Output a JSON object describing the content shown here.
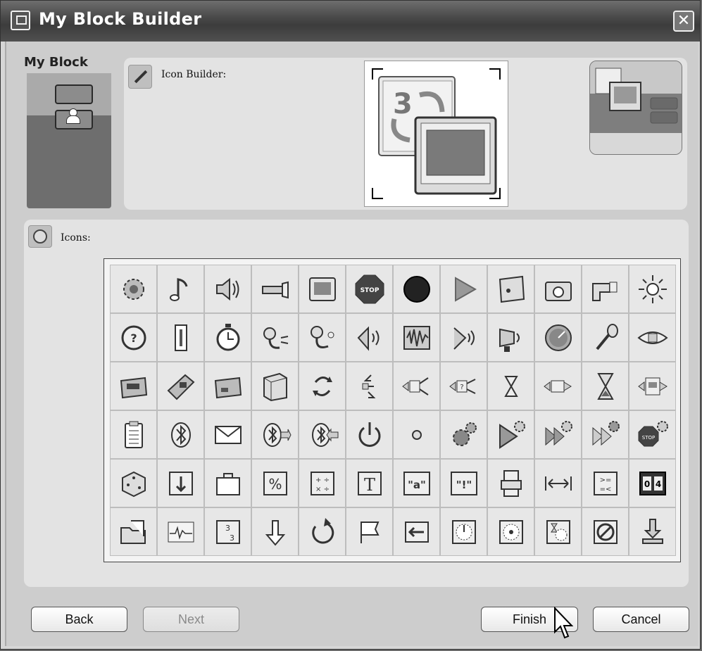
{
  "window": {
    "title": "My Block Builder",
    "close_symbol": "✕"
  },
  "my_block": {
    "label": "My Block"
  },
  "icon_builder": {
    "label": "Icon Builder:",
    "canvas_number": "3"
  },
  "icons_section": {
    "label": "Icons:",
    "icons": [
      [
        "gear",
        "music-note",
        "speaker",
        "flashlight",
        "display",
        "stop-sign",
        "red-lamp",
        "play",
        "sound-file",
        "camera",
        "light-sensor",
        "sun"
      ],
      [
        "rotation-sensor",
        "thermometer",
        "timer",
        "sound-sensor",
        "touch-probe",
        "ultrasonic",
        "waveform",
        "radar",
        "lamp-sensor",
        "compass",
        "microphone",
        "eye"
      ],
      [
        "nxt-brick",
        "nxt-brick-tilted",
        "nxt-brick-2",
        "nxt-brick-box",
        "loop",
        "switch",
        "variable-compare",
        "data-compare",
        "hourglass-small",
        "data-range",
        "hourglass",
        "keep-alive"
      ],
      [
        "notepad",
        "bluetooth",
        "mail",
        "bluetooth-send",
        "bluetooth-receive",
        "power",
        "dot",
        "gear-motor",
        "play-gear",
        "fast-forward-gear",
        "motor-forward",
        "stop-gear"
      ],
      [
        "random-dice",
        "arrow-down-box",
        "suitcase",
        "percent",
        "math-operators",
        "text",
        "quote-a",
        "quote-exclamation",
        "stack-block",
        "range-arrows",
        "compare-operators",
        "counter"
      ],
      [
        "open-folder",
        "pulse-graph",
        "countdown",
        "arrow-down",
        "reset",
        "flag",
        "arrow-left",
        "dial",
        "dial-reset",
        "timer-dial",
        "no-sign",
        "download"
      ]
    ],
    "text_glyphs": {
      "stop": "STOP",
      "text": "T",
      "quote_a": "\"a\"",
      "quote_excl": "\"!\"",
      "compare": ">=\n=<",
      "counter": "0 4",
      "percent": "%",
      "math": "+ ÷\n× ÷",
      "countdown": "3\n3"
    }
  },
  "buttons": {
    "back": "Back",
    "next": "Next",
    "finish": "Finish",
    "cancel": "Cancel"
  },
  "colors": {
    "titlebar": "#404040",
    "panel": "#e3e3e3",
    "red_lamp": "#b02020"
  }
}
